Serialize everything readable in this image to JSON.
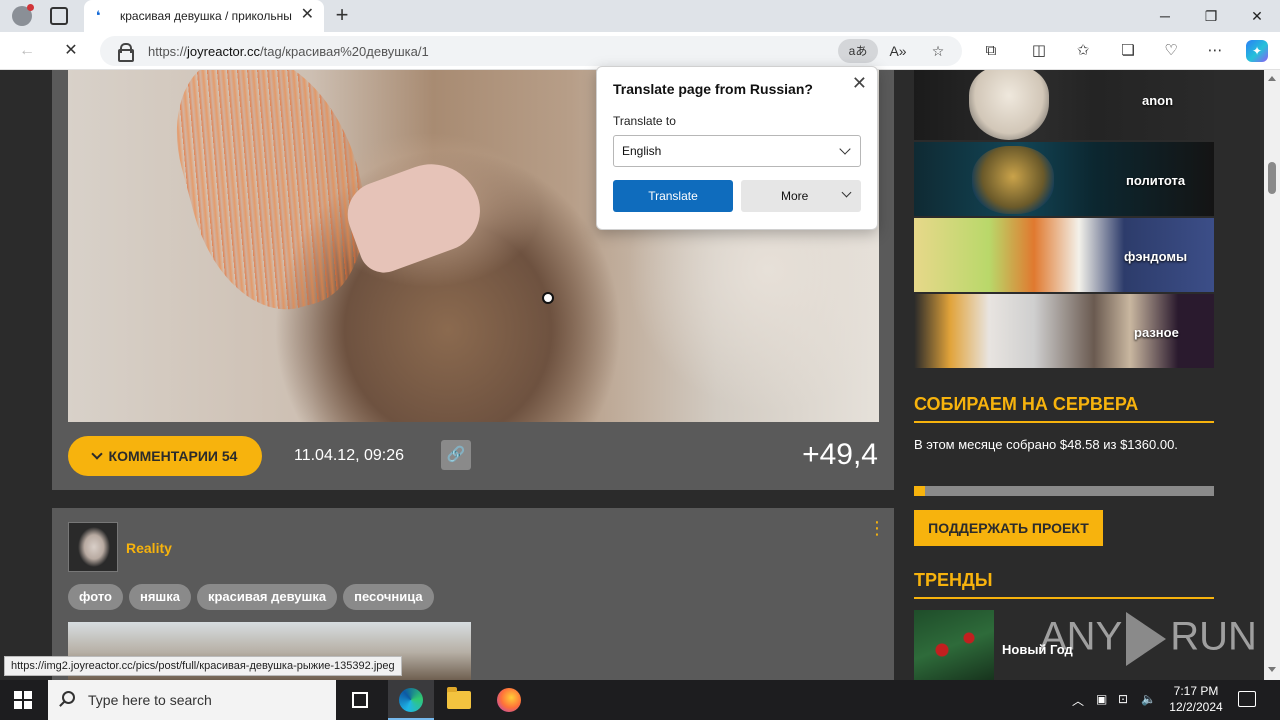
{
  "browser": {
    "tab_title": "красивая девушка / прикольные",
    "tab_favicon": "joyreactor-favicon",
    "url_prefix": "https://",
    "url_domain": "joyreactor.cc",
    "url_path": "/tag/красивая%20девушка/1",
    "translate_icon_label": "aあ",
    "read_aloud_label": "A»",
    "new_tab": "+",
    "minimize": "─",
    "maximize": "❐",
    "close": "✕"
  },
  "translate_popup": {
    "title": "Translate page from Russian?",
    "translate_to_label": "Translate to",
    "language_value": "English",
    "translate_button": "Translate",
    "more_button": "More",
    "close": "✕"
  },
  "post1": {
    "comments_label": "КОММЕНТАРИИ 54",
    "date": "11.04.12, 09:26",
    "link_icon": "🔗",
    "rating": "+49,4"
  },
  "post2": {
    "username": "Reality",
    "more": "⋮",
    "tags": [
      "фото",
      "няшка",
      "красивая девушка",
      "песочница"
    ]
  },
  "sidebar": {
    "categories": [
      {
        "label": "anon"
      },
      {
        "label": "политота"
      },
      {
        "label": "фэндомы"
      },
      {
        "label": "разное"
      }
    ],
    "donate_heading": "СОБИРАЕМ НА СЕРВЕРА",
    "donate_text": "В этом месяце собрано $48.58 из $1360.00.",
    "donate_progress": 0.036,
    "support_button": "ПОДДЕРЖАТЬ ПРОЕКТ",
    "trends_heading": "ТРЕНДЫ",
    "trend_items": [
      {
        "title": "Новый Год"
      }
    ]
  },
  "status_url": "https://img2.joyreactor.cc/pics/post/full/красивая-девушка-рыжие-135392.jpeg",
  "watermark": {
    "left": "ANY",
    "right": "RUN"
  },
  "taskbar": {
    "search_placeholder": "Type here to search",
    "time": "7:17 PM",
    "date": "12/2/2024"
  },
  "colors": {
    "accent": "#f7b30d",
    "page_bg": "#2b2b2b",
    "post_bg": "#5a5a5a",
    "translate_blue": "#0f6cbd"
  }
}
